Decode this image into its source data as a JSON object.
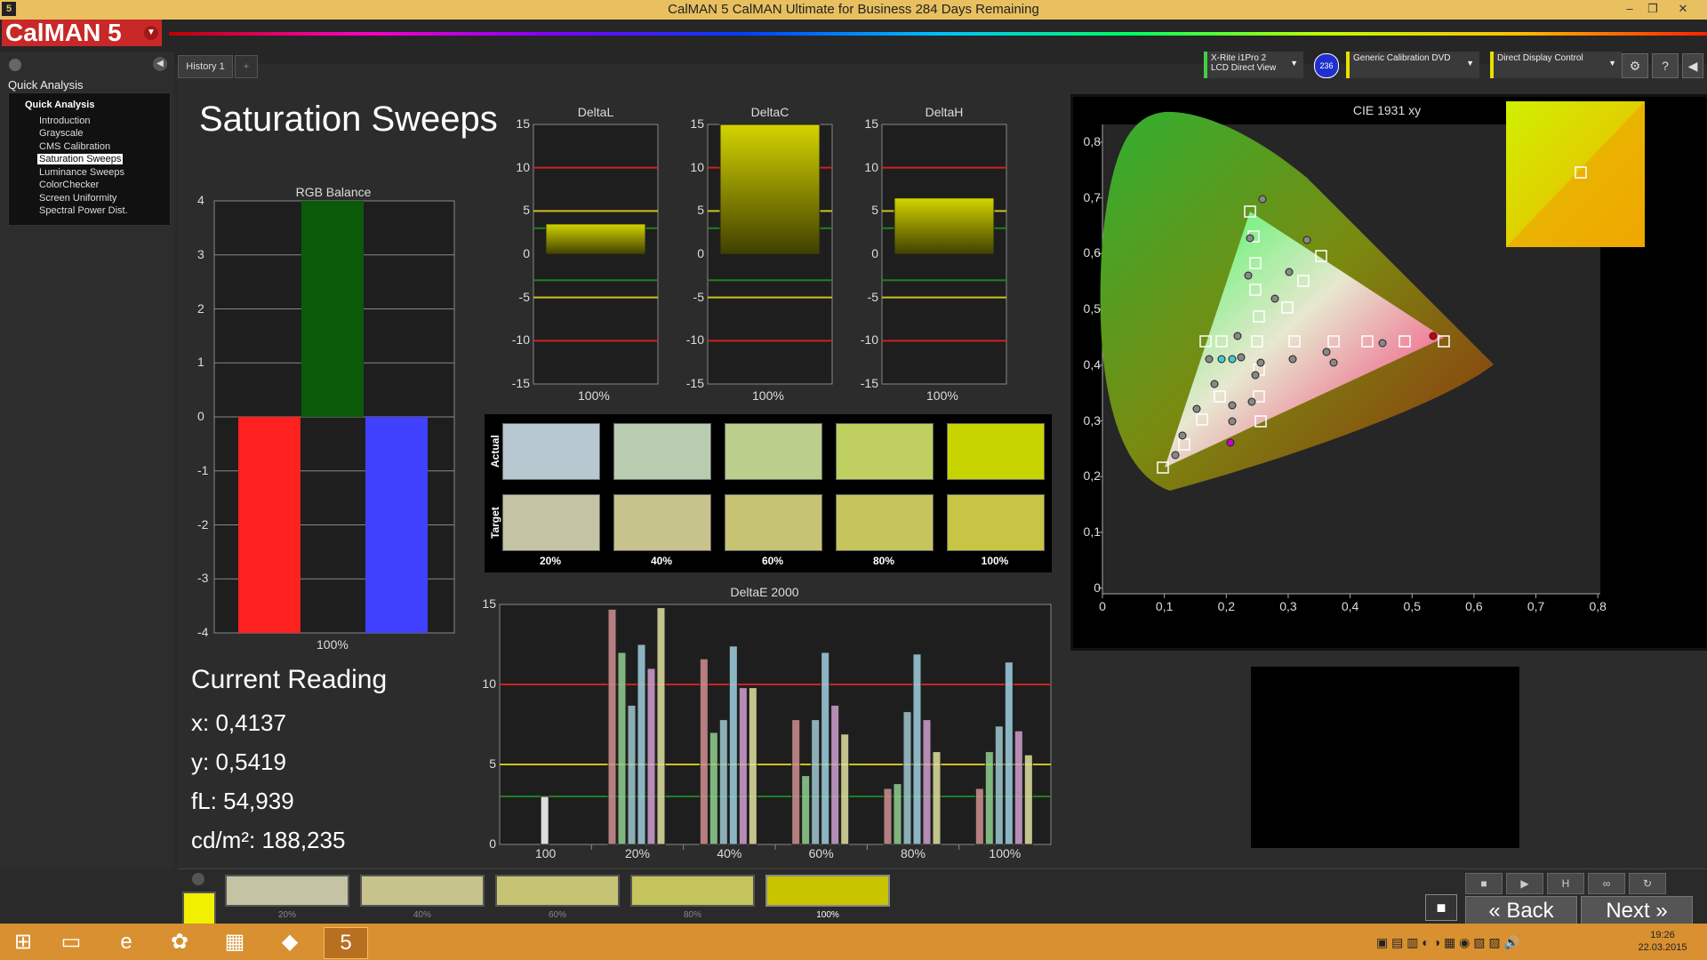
{
  "window": {
    "title": "CalMAN 5 CalMAN Ultimate for Business 284 Days Remaining",
    "app_icon": "5",
    "controls": [
      "–",
      "❐",
      "✕"
    ]
  },
  "logo": {
    "text": "CalMAN 5"
  },
  "left_panel": {
    "title": "Quick Analysis",
    "tree_root": "Quick Analysis",
    "items": [
      {
        "label": "Introduction",
        "selected": false
      },
      {
        "label": "Grayscale",
        "selected": false
      },
      {
        "label": "CMS Calibration",
        "selected": false
      },
      {
        "label": "Saturation Sweeps",
        "selected": true
      },
      {
        "label": "Luminance Sweeps",
        "selected": false
      },
      {
        "label": "ColorChecker",
        "selected": false
      },
      {
        "label": "Screen Uniformity",
        "selected": false
      },
      {
        "label": "Spectral Power Dist.",
        "selected": false
      }
    ]
  },
  "tabs": {
    "history": "History 1",
    "add": "+"
  },
  "devices": {
    "meter_line1": "X-Rite i1Pro 2",
    "meter_line2": "LCD Direct View",
    "meter_badge": "236",
    "source": "Generic Calibration DVD",
    "display": "Direct Display Control"
  },
  "page_title": "Saturation Sweeps",
  "rgb_balance": {
    "title": "RGB Balance",
    "xlabel": "100%",
    "yticks": [
      "4",
      "3",
      "2",
      "1",
      "0",
      "-1",
      "-2",
      "-3",
      "-4"
    ],
    "ylim": [
      -4,
      4
    ],
    "values": {
      "red": -4,
      "green": 4,
      "blue": -4
    },
    "colors": {
      "red": "#ff2020",
      "green": "#0a5a0a",
      "blue": "#4040ff"
    }
  },
  "delta_charts": [
    {
      "title": "DeltaL",
      "value": 3.5,
      "xlabel": "100%"
    },
    {
      "title": "DeltaC",
      "value": 15,
      "xlabel": "100%"
    },
    {
      "title": "DeltaH",
      "value": 6.5,
      "xlabel": "100%"
    }
  ],
  "delta_yticks": [
    "15",
    "10",
    "5",
    "0",
    "-5",
    "-10",
    "-15"
  ],
  "current_reading": {
    "title": "Current Reading",
    "x": "x: 0,4137",
    "y": "y: 0,5419",
    "fl": "fL: 54,939",
    "cdm2": "cd/m²: 188,235"
  },
  "swatches": {
    "actual_label": "Actual",
    "target_label": "Target",
    "labels": [
      "20%",
      "40%",
      "60%",
      "80%",
      "100%"
    ],
    "actual": [
      "#b8c8d0",
      "#b8ccb0",
      "#bcce8c",
      "#c0d060",
      "#c8d400"
    ],
    "target": [
      "#c4c4a4",
      "#c6c48c",
      "#c6c474",
      "#c6c45c",
      "#c8c444"
    ]
  },
  "chart_data": {
    "type": "bar",
    "title": "DeltaE 2000",
    "categories": [
      "100",
      "20%",
      "40%",
      "60%",
      "80%",
      "100%"
    ],
    "ylim": [
      0,
      15
    ],
    "yticks": [
      "15",
      "10",
      "5",
      "0"
    ],
    "series": [
      {
        "color": "#ffffff",
        "values": [
          3,
          null,
          null,
          null,
          null,
          null
        ]
      },
      {
        "color": "#d09090",
        "values": [
          null,
          14.7,
          11.6,
          7.8,
          3.5,
          3.5
        ]
      },
      {
        "color": "#90d090",
        "values": [
          null,
          12,
          7,
          4.3,
          3.8,
          5.8
        ]
      },
      {
        "color": "#a0c8d0",
        "values": [
          null,
          8.7,
          7.8,
          7.8,
          8.3,
          7.4
        ]
      },
      {
        "color": "#a0d0e0",
        "values": [
          null,
          12.5,
          12.4,
          12,
          11.9,
          11.4
        ]
      },
      {
        "color": "#d0a0d0",
        "values": [
          null,
          11,
          9.8,
          8.7,
          7.8,
          7.1
        ]
      },
      {
        "color": "#e0e0a0",
        "values": [
          null,
          14.8,
          9.8,
          6.9,
          5.8,
          5.6
        ]
      }
    ],
    "ref_lines": [
      10,
      5,
      3
    ]
  },
  "cie": {
    "title": "CIE 1931 xy",
    "xticks": [
      "0",
      "0,1",
      "0,2",
      "0,3",
      "0,4",
      "0,5",
      "0,6",
      "0,7",
      "0,8"
    ],
    "yticks": [
      "0,8",
      "0,7",
      "0,6",
      "0,5",
      "0,4",
      "0,3",
      "0,2",
      "0,1",
      "0"
    ]
  },
  "bottom": {
    "swatches": [
      {
        "label": "20%",
        "color": "#c4c4a4",
        "active": false
      },
      {
        "label": "40%",
        "color": "#c6c48c",
        "active": false
      },
      {
        "label": "60%",
        "color": "#c6c474",
        "active": false
      },
      {
        "label": "80%",
        "color": "#c6c45c",
        "active": false
      },
      {
        "label": "100%",
        "color": "#c8c400",
        "active": true
      }
    ],
    "back_label": "Back",
    "next_label": "Next",
    "current_color": "#f0f000"
  },
  "taskbar": {
    "time": "19:26",
    "date": "22.03.2015"
  }
}
